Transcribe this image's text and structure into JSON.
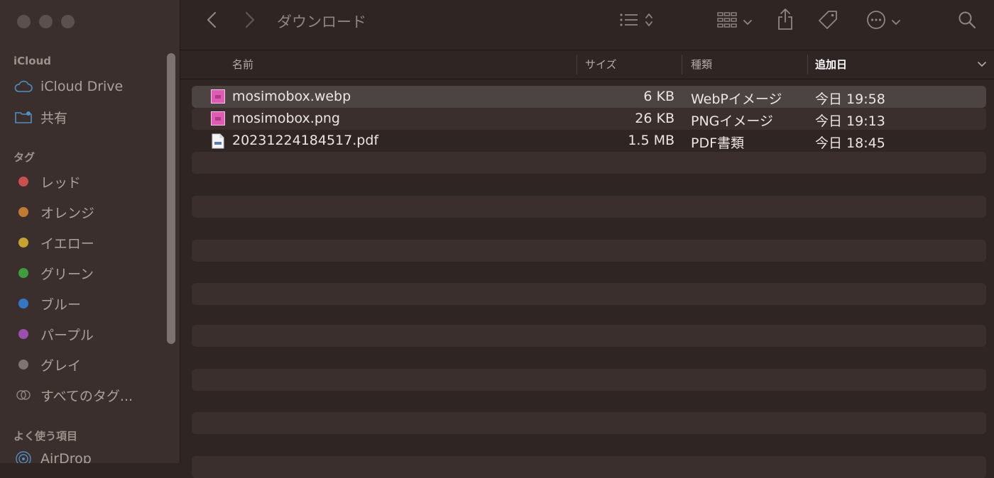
{
  "window": {
    "title": "ダウンロード"
  },
  "sidebar": {
    "icloud_section": "iCloud",
    "icloud_drive": "iCloud Drive",
    "shared": "共有",
    "tags_section": "タグ",
    "tags": [
      {
        "label": "レッド",
        "color": "#c9504d"
      },
      {
        "label": "オレンジ",
        "color": "#c27a34"
      },
      {
        "label": "イエロー",
        "color": "#c6a232"
      },
      {
        "label": "グリーン",
        "color": "#3e9e3e"
      },
      {
        "label": "ブルー",
        "color": "#3476c2"
      },
      {
        "label": "パープル",
        "color": "#9b4fae"
      },
      {
        "label": "グレイ",
        "color": "#7d7573"
      }
    ],
    "all_tags": "すべてのタグ...",
    "favorites_section": "よく使う項目",
    "airdrop": "AirDrop"
  },
  "columns": {
    "name": "名前",
    "size": "サイズ",
    "kind": "種類",
    "date_added": "追加日"
  },
  "files": [
    {
      "name": "mosimobox.webp",
      "size": "6 KB",
      "kind": "WebPイメージ",
      "date": "今日 19:58",
      "icon": "image-file-icon",
      "selected": true
    },
    {
      "name": "mosimobox.png",
      "size": "26 KB",
      "kind": "PNGイメージ",
      "date": "今日 19:13",
      "icon": "image-file-icon",
      "selected": false
    },
    {
      "name": "20231224184517.pdf",
      "size": "1.5 MB",
      "kind": "PDF書類",
      "date": "今日 18:45",
      "icon": "pdf-file-icon",
      "selected": false
    }
  ],
  "colors": {
    "accent_image": "#e05bb4",
    "selection": "#4c4442"
  }
}
